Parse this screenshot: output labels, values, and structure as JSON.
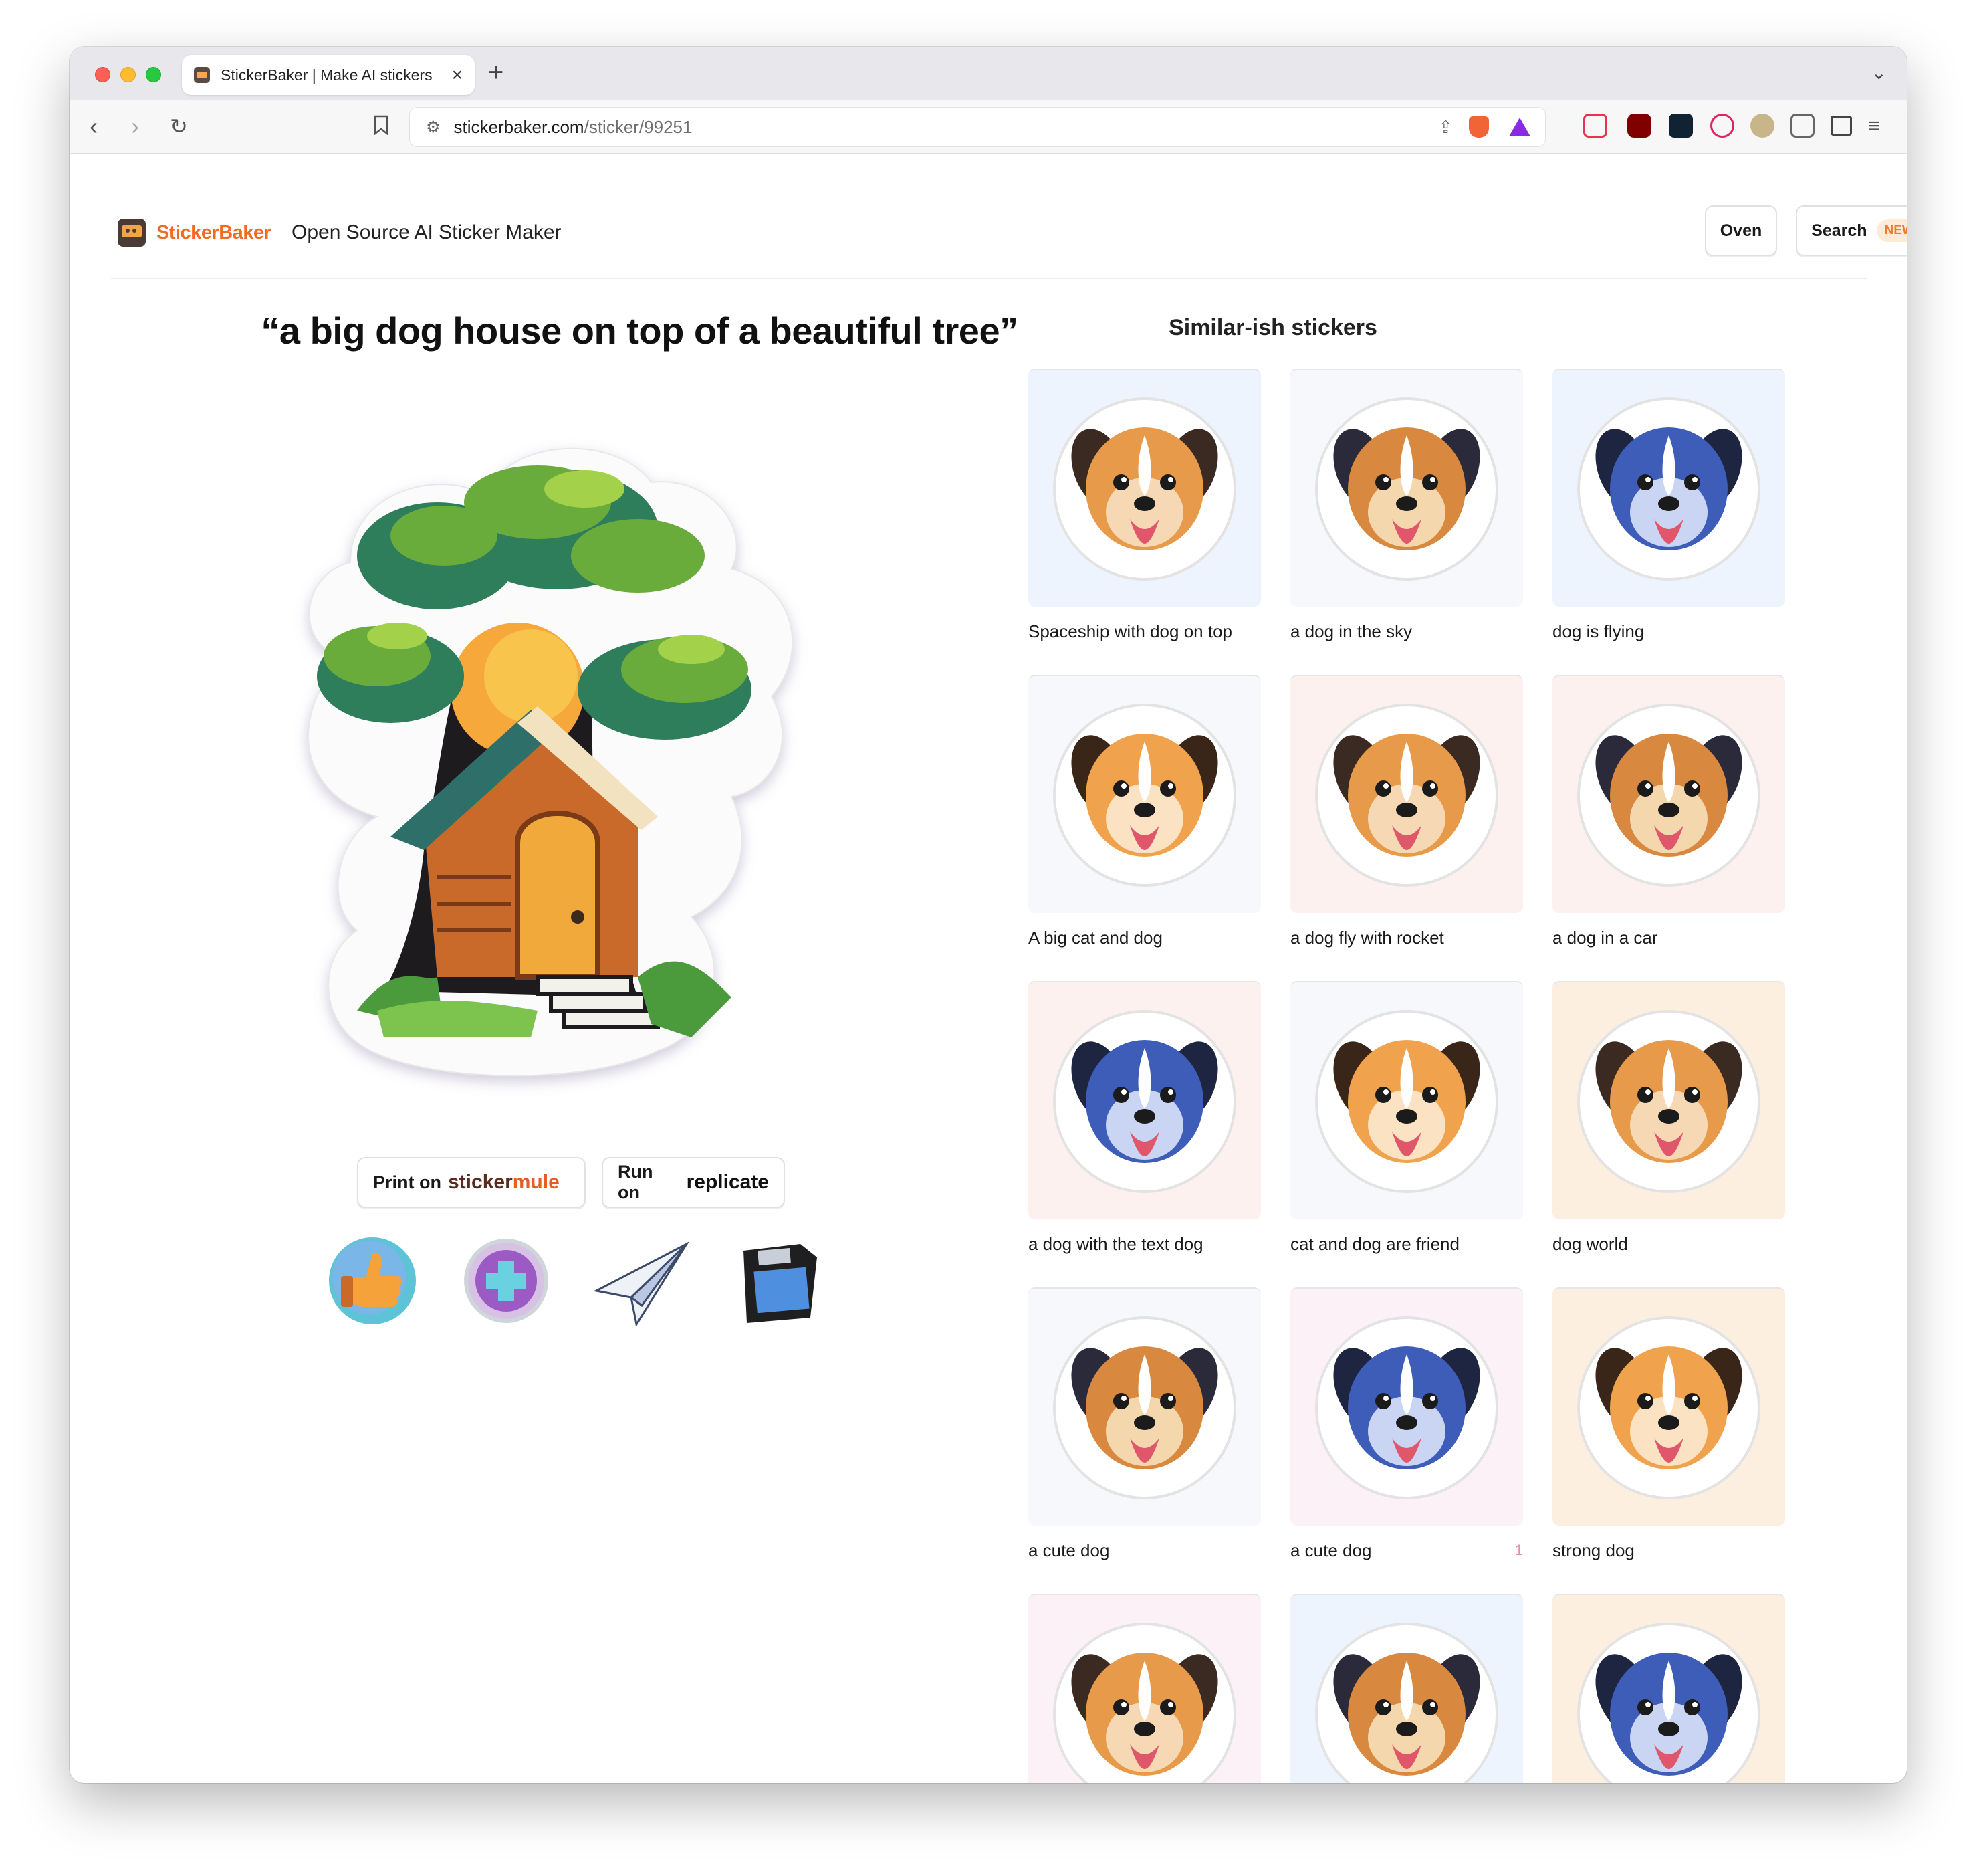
{
  "browser": {
    "tab_title": "StickerBaker | Make AI stickers",
    "url_host": "stickerbaker.com",
    "url_path": "/sticker/99251"
  },
  "header": {
    "logo_text": "StickerBaker",
    "tagline": "Open Source AI Sticker Maker",
    "oven_label": "Oven",
    "search_label": "Search",
    "search_badge": "NEW"
  },
  "sticker": {
    "prompt": "“a big dog house on top of a beautiful tree”",
    "print_prefix": "Print on",
    "print_brand_a": "sticker",
    "print_brand_b": "mule",
    "run_prefix": "Run on",
    "run_brand": "replicate"
  },
  "similar": {
    "title": "Similar-ish stickers",
    "items": [
      {
        "label": "Spaceship with dog on top",
        "bg": "#eef4fe"
      },
      {
        "label": "a dog in the sky",
        "bg": "#f6f8fb"
      },
      {
        "label": "dog is flying",
        "bg": "#eef4fe"
      },
      {
        "label": "A big cat and dog",
        "bg": "#f6f8fb"
      },
      {
        "label": "a dog fly with rocket",
        "bg": "#fcf1ef"
      },
      {
        "label": "a dog in a car",
        "bg": "#fcf1ef"
      },
      {
        "label": "a dog with the text dog",
        "bg": "#fcf1ef"
      },
      {
        "label": "cat and dog are friend",
        "bg": "#f6f8fb"
      },
      {
        "label": "dog world",
        "bg": "#fcefdf"
      },
      {
        "label": "a cute dog",
        "bg": "#f6f8fb"
      },
      {
        "label": "a cute dog",
        "bg": "#fbf1f6",
        "count": "1"
      },
      {
        "label": "strong dog",
        "bg": "#fcefdf"
      },
      {
        "label": "",
        "bg": "#fbf1f6"
      },
      {
        "label": "",
        "bg": "#eef4fe"
      },
      {
        "label": "",
        "bg": "#fcefdf"
      }
    ]
  }
}
